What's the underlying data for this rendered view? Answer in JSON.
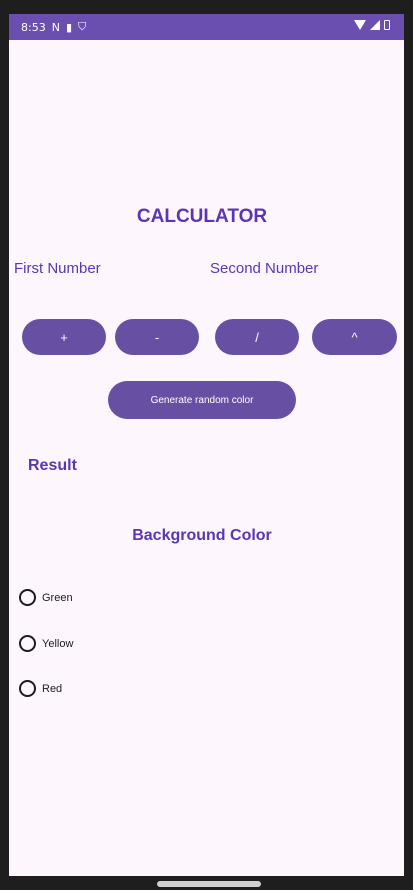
{
  "status_bar": {
    "time": "8:53",
    "icons": [
      "n-icon",
      "sim-icon",
      "shield-icon",
      "wifi-icon",
      "signal-icon",
      "battery-icon"
    ]
  },
  "app": {
    "title": "CALCULATOR",
    "first_number_label": "First Number",
    "second_number_label": "Second Number",
    "operators": {
      "add": "+",
      "subtract": "-",
      "divide": "/",
      "power": "^"
    },
    "generate_button": "Generate random color",
    "result_label": "Result",
    "background_color_title": "Background Color",
    "color_options": {
      "green": "Green",
      "yellow": "Yellow",
      "red": "Red"
    }
  },
  "colors": {
    "accent": "#6750a4",
    "title_text": "#5b35b2",
    "background": "#fdf7fd",
    "status_bar": "#6a4fb0"
  }
}
